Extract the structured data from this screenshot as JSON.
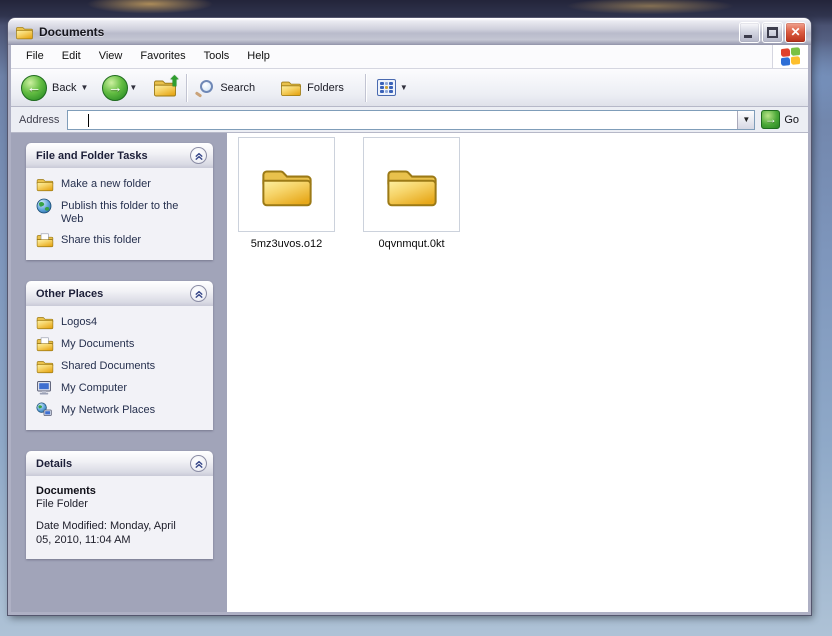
{
  "window": {
    "title": "Documents"
  },
  "menu": {
    "items": [
      "File",
      "Edit",
      "View",
      "Favorites",
      "Tools",
      "Help"
    ]
  },
  "toolbar": {
    "back_label": "Back",
    "search_label": "Search",
    "folders_label": "Folders"
  },
  "address_bar": {
    "label": "Address",
    "value": "",
    "go_label": "Go"
  },
  "sidebar": {
    "panels": [
      {
        "title": "File and Folder Tasks",
        "items": [
          {
            "label": "Make a new folder"
          },
          {
            "label": "Publish this folder to the Web"
          },
          {
            "label": "Share this folder"
          }
        ]
      },
      {
        "title": "Other Places",
        "items": [
          {
            "label": "Logos4"
          },
          {
            "label": "My Documents"
          },
          {
            "label": "Shared Documents"
          },
          {
            "label": "My Computer"
          },
          {
            "label": "My Network Places"
          }
        ]
      },
      {
        "title": "Details"
      }
    ],
    "details": {
      "name": "Documents",
      "type": "File Folder",
      "date_modified": "Date Modified: Monday, April 05, 2010, 11:04 AM"
    }
  },
  "files": [
    {
      "name": "5mz3uvos.o12",
      "type": "folder"
    },
    {
      "name": "0qvnmqut.0kt",
      "type": "folder"
    }
  ],
  "colors": {
    "accent_green": "#2f9128",
    "close_red": "#c03a22",
    "sidebar_bg": "#a1a4b9",
    "folder_yellow": "#f0c550"
  }
}
